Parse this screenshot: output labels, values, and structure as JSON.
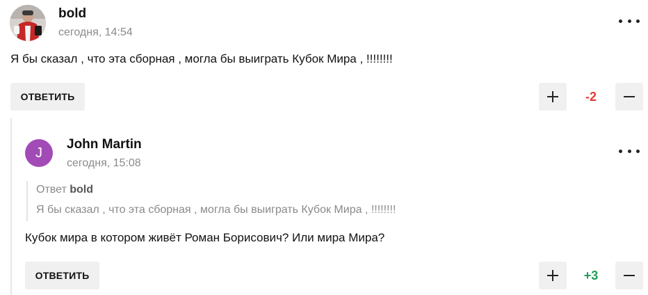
{
  "comments": [
    {
      "author": "bold",
      "time": "сегодня, 14:54",
      "text": "Я бы сказал , что эта сборная , могла бы выиграть Кубок Мира , !!!!!!!!",
      "reply_label": "ОТВЕТИТЬ",
      "score": "-2",
      "score_color": "#e53935"
    },
    {
      "author": "John Martin",
      "avatar_letter": "J",
      "avatar_color": "#a24bb7",
      "time": "сегодня, 15:08",
      "quote": {
        "prefix": "Ответ",
        "author": "bold",
        "text": "Я бы сказал , что эта сборная , могла бы выиграть Кубок Мира , !!!!!!!!"
      },
      "text": "Кубок мира в котором живёт Роман Борисович? Или мира Мира?",
      "reply_label": "ОТВЕТИТЬ",
      "score": "+3",
      "score_color": "#1e9e5a"
    }
  ],
  "icons": {
    "more": "more-dots-icon",
    "upvote": "plus-icon",
    "downvote": "minus-icon"
  }
}
